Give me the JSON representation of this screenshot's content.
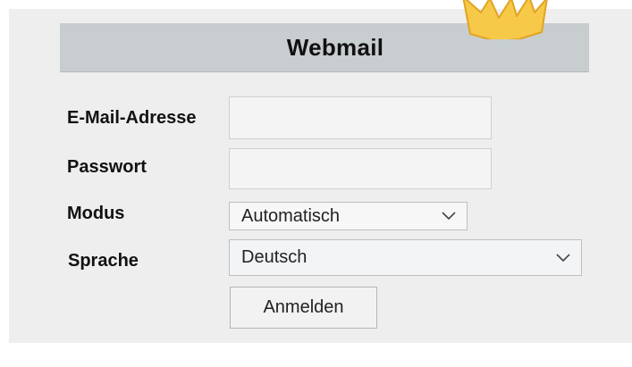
{
  "header": {
    "title": "Webmail"
  },
  "form": {
    "email": {
      "label": "E-Mail-Adresse",
      "value": "",
      "placeholder": ""
    },
    "password": {
      "label": "Passwort",
      "value": "",
      "placeholder": ""
    },
    "mode": {
      "label": "Modus",
      "selected": "Automatisch"
    },
    "language": {
      "label": "Sprache",
      "selected": "Deutsch"
    },
    "submit_label": "Anmelden"
  },
  "icons": {
    "dropdown": "chevron-down-icon",
    "decoration": "starburst-icon"
  },
  "colors": {
    "panel_background": "#eeeeee",
    "header_background": "#c8cdd0",
    "starburst_fill": "#f7c948",
    "starburst_stroke": "#e0a422"
  }
}
